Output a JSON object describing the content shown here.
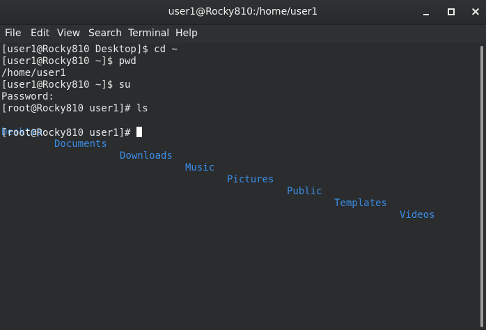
{
  "window": {
    "title": "user1@Rocky810:/home/user1",
    "controls": {
      "minimize": "minimize",
      "maximize": "maximize",
      "close": "×"
    }
  },
  "menubar": {
    "items": [
      "File",
      "Edit",
      "View",
      "Search",
      "Terminal",
      "Help"
    ]
  },
  "terminal": {
    "lines": [
      "[user1@Rocky810 Desktop]$ cd ~",
      "[user1@Rocky810 ~]$ pwd",
      "/home/user1",
      "[user1@Rocky810 ~]$ su",
      "Password:",
      "[root@Rocky810 user1]# ls"
    ],
    "ls_output": [
      "Desktop",
      "Documents",
      "Downloads",
      "Music",
      "Pictures",
      "Public",
      "Templates",
      "Videos"
    ],
    "prompt": "[root@Rocky810 user1]# "
  },
  "colors": {
    "background": "#2a2c2e",
    "text": "#e8e8e8",
    "directory": "#3b8ee6",
    "titlebar": "#2f3234"
  },
  "icons": {
    "minimize": "minimize-icon",
    "maximize": "maximize-icon",
    "close": "close-icon"
  }
}
